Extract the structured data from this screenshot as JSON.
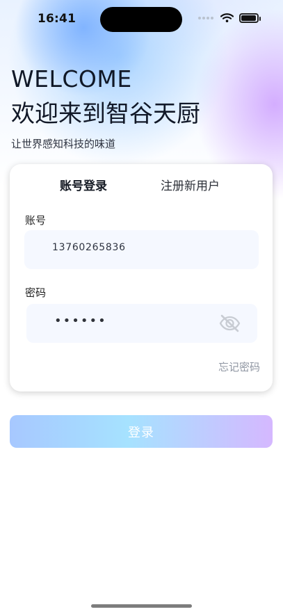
{
  "status": {
    "time": "16:41"
  },
  "hero": {
    "welcome": "WELCOME",
    "headline": "欢迎来到智谷天厨",
    "subtitle": "让世界感知科技的味道"
  },
  "tabs": [
    {
      "label": "账号登录",
      "active": true
    },
    {
      "label": "注册新用户",
      "active": false
    }
  ],
  "form": {
    "account": {
      "label": "账号",
      "value": "13760265836"
    },
    "password": {
      "label": "密码",
      "masked_value": "••••••"
    },
    "forgot_password": "忘记密码"
  },
  "actions": {
    "login": "登录"
  },
  "icons": {
    "wifi": "wifi-icon",
    "battery": "battery-icon",
    "password_visibility": "eye-off-icon"
  },
  "colors": {
    "primary_text": "#111827",
    "muted_text": "#8f96a2",
    "input_bg": "#f5f8ff",
    "gradient_start": "#a7c8ff",
    "gradient_mid": "#a6e2ff",
    "gradient_end": "#d5b8ff"
  }
}
